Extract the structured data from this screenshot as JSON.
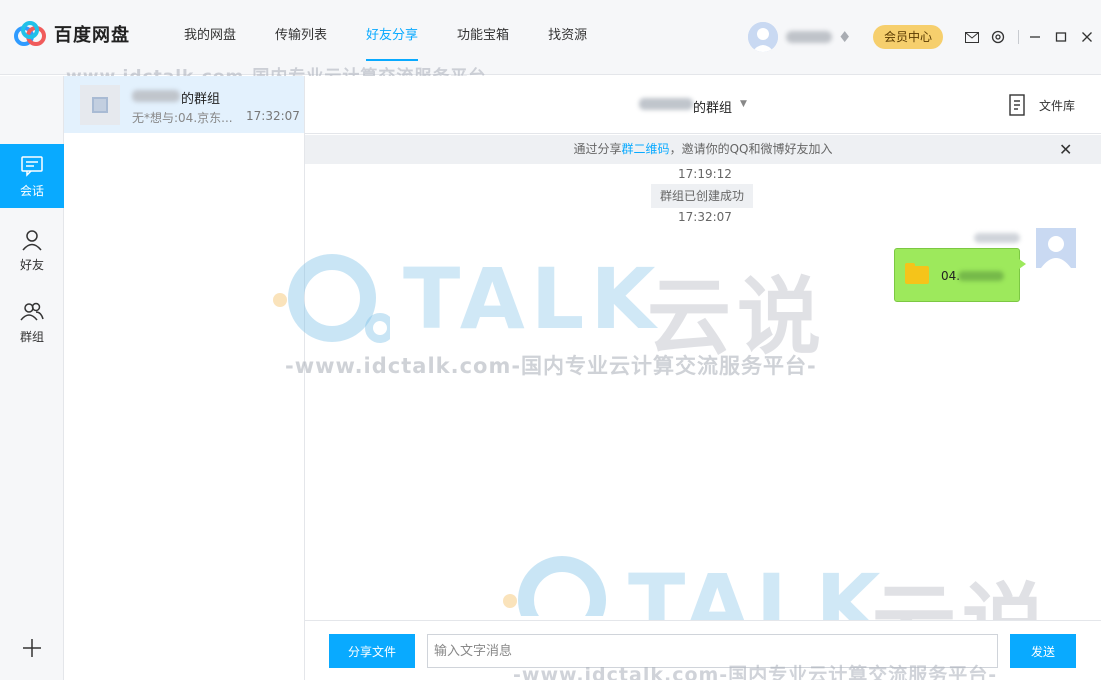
{
  "app": {
    "brand": "百度网盘",
    "nav": [
      "我的网盘",
      "传输列表",
      "好友分享",
      "功能宝箱",
      "找资源"
    ],
    "active_nav": 2,
    "vip_label": "会员中心",
    "icons": [
      "mail-icon",
      "settings-icon",
      "minimize-icon",
      "maximize-icon",
      "close-icon"
    ]
  },
  "sidebar": {
    "items": [
      {
        "label": "会话",
        "icon": "chat-icon",
        "active": true
      },
      {
        "label": "好友",
        "icon": "friend-icon",
        "active": false
      },
      {
        "label": "群组",
        "icon": "group-icon",
        "active": false
      }
    ],
    "add_icon": "plus-icon"
  },
  "sessions": [
    {
      "name": "的群组",
      "preview": "无*想与:04.京东...",
      "time": "17:32:07"
    }
  ],
  "chat": {
    "title": "的群组",
    "file_library": "文件库",
    "notice_pre": "通过分享",
    "notice_link": "群二维码",
    "notice_post": "，邀请你的QQ和微博好友加入",
    "time1": "17:19:12",
    "system_msg": "群组已创建成功",
    "time2": "17:32:07",
    "file_msg_prefix": "04."
  },
  "composer": {
    "share_label": "分享文件",
    "placeholder": "输入文字消息",
    "send_label": "发送"
  },
  "watermark": {
    "brand": "TALK",
    "cn": "云说",
    "line": "-www.idctalk.com-国内专业云计算交流服务平台-"
  },
  "colors": {
    "accent": "#09aaff",
    "vip": "#f6cf6d",
    "bubble": "#9de95c"
  }
}
